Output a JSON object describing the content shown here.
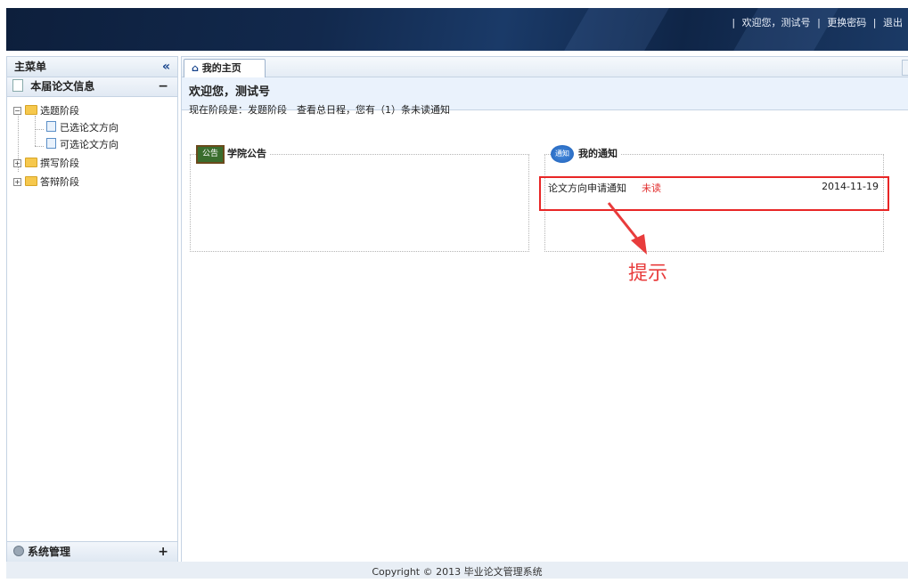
{
  "header": {
    "separator": "|",
    "welcome": "欢迎您，测试号",
    "change_password": "更换密码",
    "logout": "退出"
  },
  "sidebar": {
    "title": "主菜单",
    "collapse_glyph": "«",
    "section": {
      "label": "本届论文信息",
      "toggle": "−"
    },
    "tree": {
      "stage1": {
        "label": "选题阶段",
        "toggle": "−"
      },
      "item_selected": "已选论文方向",
      "item_available": "可选论文方向",
      "stage2": {
        "label": "撰写阶段",
        "toggle": "+"
      },
      "stage3": {
        "label": "答辩阶段",
        "toggle": "+"
      }
    },
    "system": {
      "label": "系统管理",
      "toggle": "+"
    }
  },
  "tabs": {
    "home": "我的主页",
    "home_icon": "⌂"
  },
  "welcome": {
    "title": "欢迎您，测试号",
    "status": "现在阶段是：发题阶段　查看总日程，您有（1）条未读通知"
  },
  "announcements": {
    "icon_text": "公告",
    "title": "学院公告"
  },
  "notifications": {
    "icon_text": "通知",
    "title": "我的通知",
    "items": [
      {
        "title": "论文方向申请通知",
        "status": "未读",
        "date": "2014-11-19"
      }
    ]
  },
  "annotation": {
    "text": "提示",
    "color": "#e83c3c"
  },
  "footer": {
    "copyright": "Copyright © 2013 毕业论文管理系统"
  },
  "colors": {
    "header": "#12294d",
    "accent": "#15428b",
    "alert": "#e82626"
  }
}
